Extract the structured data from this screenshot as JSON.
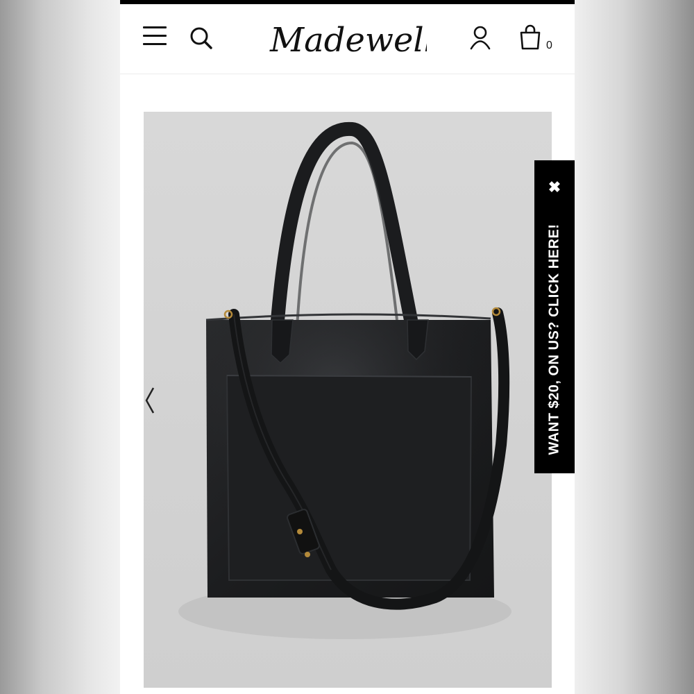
{
  "header": {
    "brand": "Madewell",
    "bag_count": "0"
  },
  "product": {
    "image": "black leather tote bag with shoulder straps and crossbody strap"
  },
  "promo": {
    "close_icon": "close-icon",
    "text": "WANT $20, ON US? CLICK HERE!"
  },
  "colors": {
    "accent": "#000000",
    "background": "#ffffff",
    "product_bg": "#d4d4d4"
  }
}
